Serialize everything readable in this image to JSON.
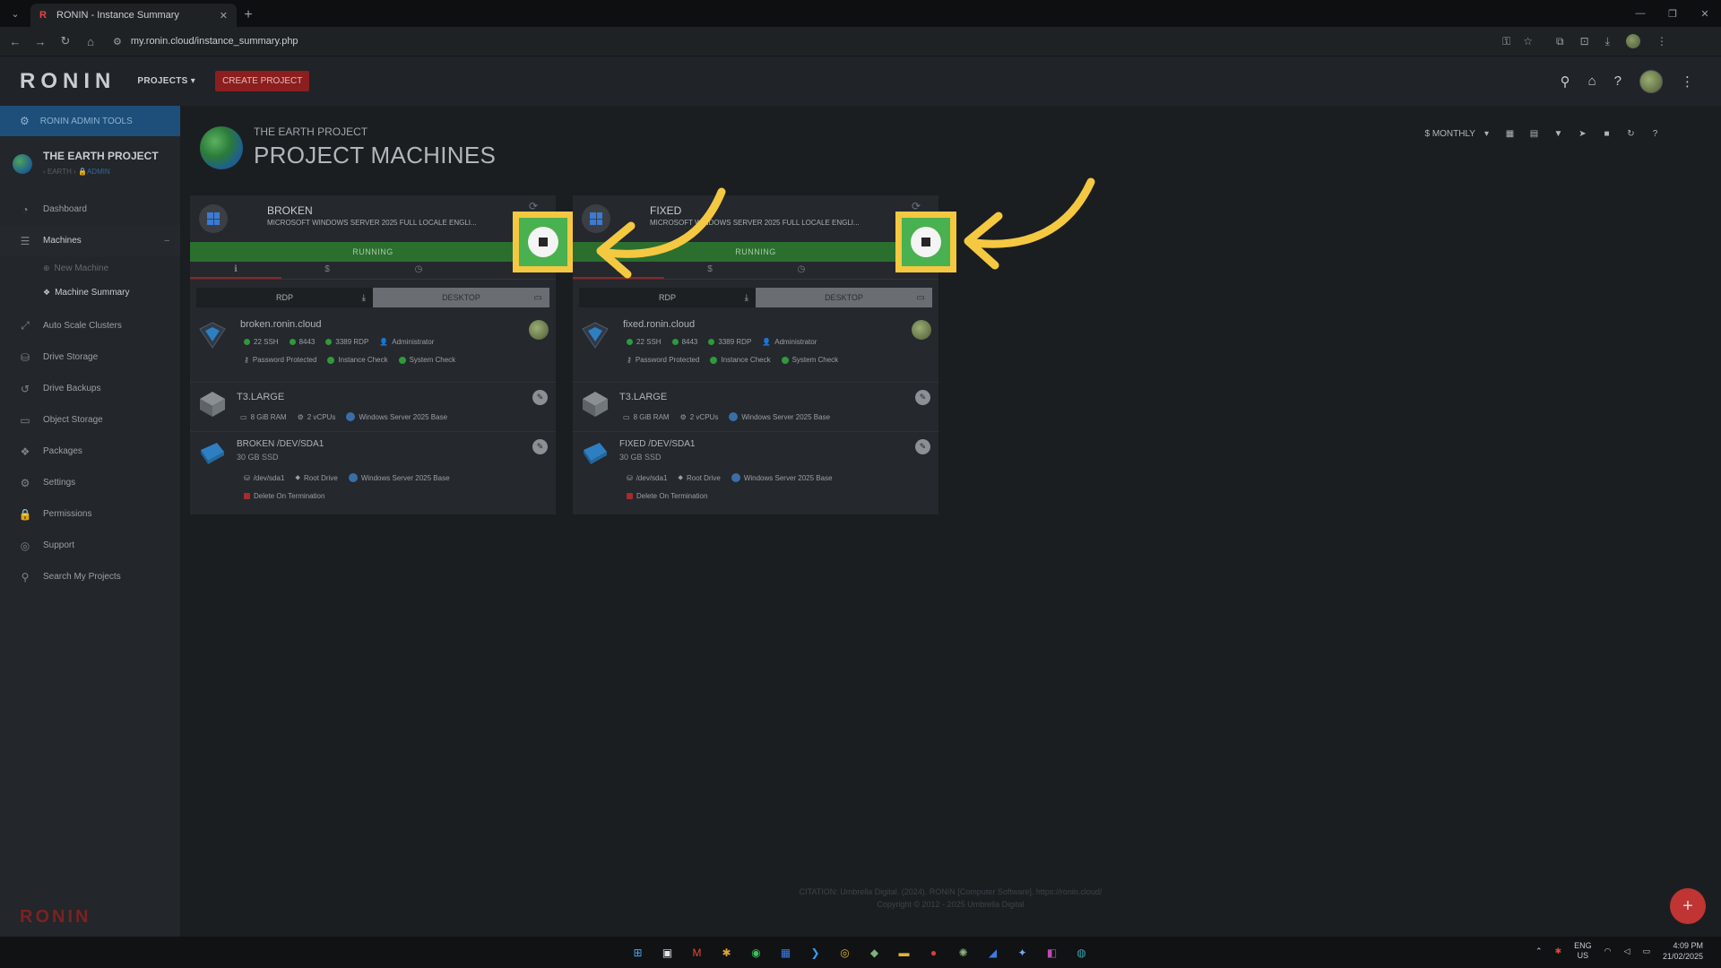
{
  "browser": {
    "tab_title": "RONIN - Instance Summary",
    "url": "my.ronin.cloud/instance_summary.php"
  },
  "header": {
    "logo": "RONIN",
    "projects_label": "PROJECTS",
    "create_label": "CREATE PROJECT"
  },
  "sidebar": {
    "admin_tools": "RONIN ADMIN TOOLS",
    "project_name": "THE EARTH PROJECT",
    "project_path": "‹ EARTH ›",
    "project_role": "ADMIN",
    "items": [
      {
        "label": "Dashboard",
        "icon": "dashboard-icon"
      },
      {
        "label": "Machines",
        "icon": "machines-icon"
      },
      {
        "label": "Auto Scale Clusters",
        "icon": "expand-icon"
      },
      {
        "label": "Drive Storage",
        "icon": "drive-icon"
      },
      {
        "label": "Drive Backups",
        "icon": "history-icon"
      },
      {
        "label": "Object Storage",
        "icon": "folder-icon"
      },
      {
        "label": "Packages",
        "icon": "packages-icon"
      },
      {
        "label": "Settings",
        "icon": "gear-icon"
      },
      {
        "label": "Permissions",
        "icon": "lock-icon"
      },
      {
        "label": "Support",
        "icon": "lifebuoy-icon"
      },
      {
        "label": "Search My Projects",
        "icon": "search-icon"
      }
    ],
    "sub_items": [
      {
        "label": "New Machine"
      },
      {
        "label": "Machine Summary"
      }
    ],
    "bottom_logo": "RONIN"
  },
  "page": {
    "kicker": "THE EARTH PROJECT",
    "title": "PROJECT MACHINES",
    "billing_period": "MONTHLY"
  },
  "machines": [
    {
      "name": "BROKEN",
      "os": "MICROSOFT WINDOWS SERVER 2025 FULL LOCALE ENGLI...",
      "status": "RUNNING",
      "rdp_label": "RDP",
      "desktop_label": "DESKTOP",
      "host": "broken.ronin.cloud",
      "ports": [
        "22 SSH",
        "8443",
        "3389 RDP"
      ],
      "user": "Administrator",
      "checks": [
        "Password Protected",
        "Instance Check",
        "System Check"
      ],
      "instance_type": "T3.LARGE",
      "ram": "8 GiB RAM",
      "vcpus": "2 vCPUs",
      "image": "Windows Server 2025 Base",
      "drive_name": "BROKEN /DEV/SDA1",
      "drive_size": "30 GB SSD",
      "device": "/dev/sda1",
      "root": "Root Drive",
      "drive_image": "Windows Server 2025 Base",
      "delete": "Delete On Termination"
    },
    {
      "name": "FIXED",
      "os": "MICROSOFT WINDOWS SERVER 2025 FULL LOCALE ENGLI...",
      "status": "RUNNING",
      "rdp_label": "RDP",
      "desktop_label": "DESKTOP",
      "host": "fixed.ronin.cloud",
      "ports": [
        "22 SSH",
        "8443",
        "3389 RDP"
      ],
      "user": "Administrator",
      "checks": [
        "Password Protected",
        "Instance Check",
        "System Check"
      ],
      "instance_type": "T3.LARGE",
      "ram": "8 GiB RAM",
      "vcpus": "2 vCPUs",
      "image": "Windows Server 2025 Base",
      "drive_name": "FIXED /DEV/SDA1",
      "drive_size": "30 GB SSD",
      "device": "/dev/sda1",
      "root": "Root Drive",
      "drive_image": "Windows Server 2025 Base",
      "delete": "Delete On Termination"
    }
  ],
  "footer": {
    "citation": "CITATION: Umbrella Digital. (2024). RONIN [Computer Software]. https://ronin.cloud/",
    "copyright": "Copyright © 2012 - 2025 Umbrella Digital"
  },
  "taskbar": {
    "lang_1": "ENG",
    "lang_2": "US",
    "time": "4:09 PM",
    "date": "21/02/2025"
  },
  "colors": {
    "running": "#2b6f2f",
    "highlight": "#f5c842",
    "accent_red": "#8b1e1e",
    "admin_blue": "#1d4f7a"
  }
}
